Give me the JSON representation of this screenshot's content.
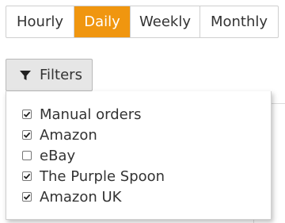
{
  "tabs": [
    {
      "label": "Hourly",
      "active": false
    },
    {
      "label": "Daily",
      "active": true
    },
    {
      "label": "Weekly",
      "active": false
    },
    {
      "label": "Monthly",
      "active": false
    }
  ],
  "filters_button": {
    "label": "Filters",
    "icon": "filter-icon"
  },
  "filter_options": [
    {
      "label": "Manual orders",
      "checked": true
    },
    {
      "label": "Amazon",
      "checked": true
    },
    {
      "label": "eBay",
      "checked": false
    },
    {
      "label": "The Purple Spoon",
      "checked": true
    },
    {
      "label": "Amazon UK",
      "checked": true
    }
  ],
  "colors": {
    "active_tab": "#f0960f",
    "button_bg": "#e6e6e6",
    "border": "#cfcfcf"
  }
}
